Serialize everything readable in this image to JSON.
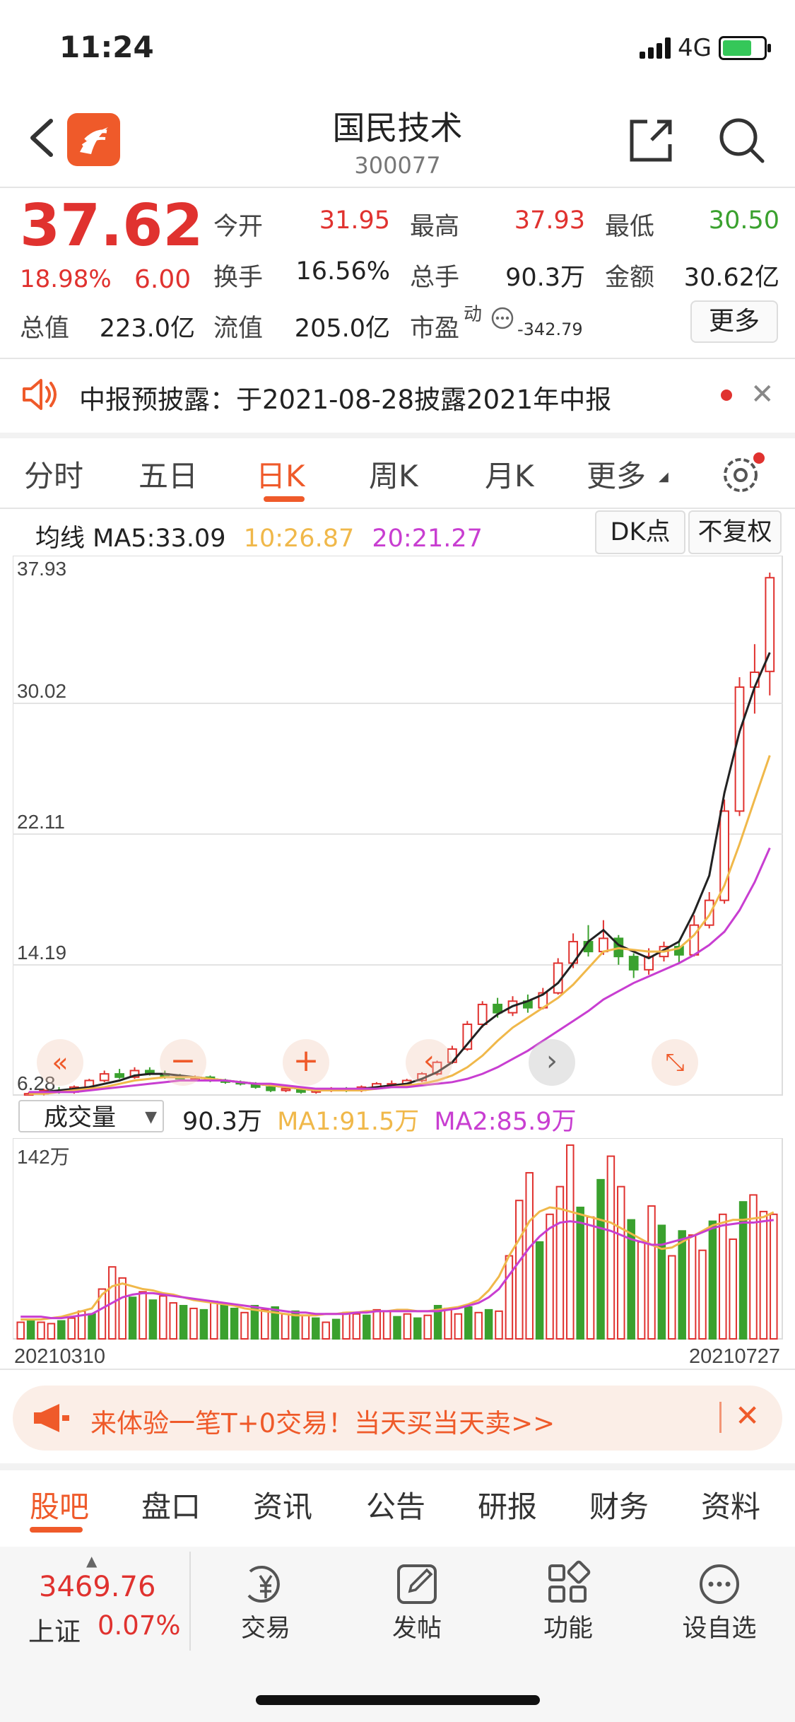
{
  "status": {
    "time": "11:24",
    "network": "4G"
  },
  "header": {
    "name": "国民技术",
    "code": "300077"
  },
  "quote": {
    "price": "37.62",
    "pct": "18.98%",
    "change": "6.00",
    "open_label": "今开",
    "open": "31.95",
    "high_label": "最高",
    "high": "37.93",
    "low_label": "最低",
    "low": "30.50",
    "turnover_label": "换手",
    "turnover": "16.56%",
    "volume_label": "总手",
    "volume": "90.3万",
    "amount_label": "金额",
    "amount": "30.62亿",
    "mktcap_label": "总值",
    "mktcap": "223.0亿",
    "float_label": "流值",
    "float": "205.0亿",
    "pe_label": "市盈",
    "pe_sup": "动",
    "pe": "-342.79",
    "more": "更多"
  },
  "notice": {
    "text": "中报预披露：于2021-08-28披露2021年中报"
  },
  "ktabs": [
    "分时",
    "五日",
    "日K",
    "周K",
    "月K",
    "更多"
  ],
  "ma": {
    "label": "均线",
    "ma5": "MA5:33.09",
    "ma10": "10:26.87",
    "ma20": "20:21.27",
    "btn_dk": "DK点",
    "btn_fq": "不复权",
    "color_ma10": "#f0b84a",
    "color_ma20": "#c83ed1"
  },
  "volume_header": {
    "select": "成交量",
    "value": "90.3万",
    "ma1": "MA1:91.5万",
    "ma2": "MA2:85.9万"
  },
  "chart_data": [
    {
      "type": "candlestick",
      "y_ticks": [
        "37.93",
        "30.02",
        "22.11",
        "14.19",
        "6.28"
      ],
      "ylim": [
        6.28,
        37.93
      ],
      "series": [
        {
          "name": "MA5",
          "values": [
            6.4,
            6.5,
            6.6,
            6.7,
            6.8,
            7.0,
            7.2,
            7.5,
            7.6,
            7.6,
            7.5,
            7.4,
            7.3,
            7.2,
            7.1,
            7.0,
            6.9,
            6.8,
            6.7,
            6.6,
            6.6,
            6.6,
            6.7,
            6.8,
            6.9,
            7.0,
            7.3,
            7.7,
            8.3,
            9.4,
            10.5,
            11.2,
            11.7,
            12.0,
            12.4,
            13.1,
            14.3,
            15.6,
            16.3,
            15.4,
            15.0,
            14.6,
            15.1,
            15.6,
            17.4,
            19.6,
            24.6,
            28.3,
            31.0,
            33.09
          ]
        },
        {
          "name": "10",
          "values": [
            6.4,
            6.4,
            6.5,
            6.6,
            6.7,
            6.8,
            7.0,
            7.2,
            7.3,
            7.4,
            7.4,
            7.4,
            7.3,
            7.2,
            7.1,
            7.0,
            6.9,
            6.8,
            6.7,
            6.6,
            6.6,
            6.6,
            6.6,
            6.7,
            6.8,
            6.9,
            7.0,
            7.2,
            7.5,
            8.0,
            8.7,
            9.6,
            10.4,
            11.0,
            11.6,
            12.2,
            13.0,
            14.0,
            15.0,
            15.2,
            15.1,
            15.0,
            15.0,
            15.2,
            16.0,
            17.2,
            19.0,
            21.5,
            24.2,
            26.87
          ]
        },
        {
          "name": "20",
          "values": [
            6.5,
            6.5,
            6.5,
            6.5,
            6.6,
            6.7,
            6.8,
            6.9,
            7.0,
            7.1,
            7.2,
            7.2,
            7.2,
            7.2,
            7.1,
            7.0,
            7.0,
            6.9,
            6.8,
            6.7,
            6.7,
            6.7,
            6.7,
            6.7,
            6.8,
            6.8,
            6.9,
            7.0,
            7.1,
            7.3,
            7.6,
            8.0,
            8.5,
            9.0,
            9.6,
            10.2,
            10.8,
            11.4,
            12.1,
            12.6,
            13.1,
            13.5,
            13.9,
            14.3,
            14.8,
            15.4,
            16.2,
            17.5,
            19.2,
            21.27
          ]
        }
      ],
      "candles": [
        [
          6.3,
          6.4,
          6.5,
          6.2
        ],
        [
          6.4,
          6.6,
          6.7,
          6.3
        ],
        [
          6.6,
          6.5,
          6.8,
          6.4
        ],
        [
          6.5,
          6.8,
          6.9,
          6.4
        ],
        [
          6.8,
          7.2,
          7.3,
          6.7
        ],
        [
          7.2,
          7.6,
          7.8,
          7.1
        ],
        [
          7.6,
          7.4,
          7.9,
          7.3
        ],
        [
          7.4,
          7.8,
          8.0,
          7.3
        ],
        [
          7.8,
          7.6,
          8.0,
          7.5
        ],
        [
          7.6,
          7.4,
          7.8,
          7.3
        ],
        [
          7.4,
          7.3,
          7.6,
          7.2
        ],
        [
          7.3,
          7.4,
          7.5,
          7.2
        ],
        [
          7.4,
          7.2,
          7.5,
          7.1
        ],
        [
          7.2,
          7.1,
          7.3,
          7.0
        ],
        [
          7.1,
          7.0,
          7.2,
          6.9
        ],
        [
          7.0,
          6.8,
          7.1,
          6.7
        ],
        [
          6.8,
          6.6,
          6.9,
          6.5
        ],
        [
          6.6,
          6.7,
          6.8,
          6.5
        ],
        [
          6.7,
          6.5,
          6.8,
          6.4
        ],
        [
          6.5,
          6.6,
          6.7,
          6.4
        ],
        [
          6.6,
          6.7,
          6.8,
          6.5
        ],
        [
          6.7,
          6.6,
          6.8,
          6.5
        ],
        [
          6.6,
          6.8,
          6.9,
          6.5
        ],
        [
          6.8,
          7.0,
          7.1,
          6.7
        ],
        [
          7.0,
          7.0,
          7.2,
          6.9
        ],
        [
          7.0,
          7.2,
          7.3,
          6.9
        ],
        [
          7.2,
          7.6,
          7.7,
          7.1
        ],
        [
          7.6,
          8.3,
          8.4,
          7.5
        ],
        [
          8.3,
          9.1,
          9.3,
          8.2
        ],
        [
          9.1,
          10.6,
          10.8,
          9.0
        ],
        [
          10.6,
          11.8,
          12.0,
          10.4
        ],
        [
          11.8,
          11.3,
          12.2,
          11.0
        ],
        [
          11.3,
          12.0,
          12.3,
          11.1
        ],
        [
          12.0,
          11.6,
          12.4,
          11.3
        ],
        [
          11.6,
          12.5,
          12.8,
          11.5
        ],
        [
          12.5,
          14.3,
          14.6,
          12.4
        ],
        [
          14.3,
          15.6,
          16.1,
          14.0
        ],
        [
          15.6,
          15.0,
          16.6,
          14.7
        ],
        [
          15.0,
          15.8,
          16.9,
          14.8
        ],
        [
          15.8,
          14.7,
          16.0,
          14.2
        ],
        [
          14.7,
          13.9,
          14.9,
          13.4
        ],
        [
          13.9,
          14.7,
          15.2,
          13.6
        ],
        [
          14.7,
          15.3,
          15.6,
          14.4
        ],
        [
          15.3,
          14.8,
          15.7,
          14.3
        ],
        [
          14.8,
          16.6,
          17.2,
          14.7
        ],
        [
          16.6,
          18.1,
          18.6,
          16.4
        ],
        [
          18.1,
          23.5,
          24.2,
          17.9
        ],
        [
          23.5,
          31.0,
          31.6,
          23.2
        ],
        [
          31.0,
          31.9,
          33.6,
          29.4
        ],
        [
          31.95,
          37.62,
          37.93,
          30.5
        ]
      ]
    },
    {
      "type": "bar",
      "y_ticks": [
        "142万"
      ],
      "ylim": [
        0,
        142
      ],
      "x_ticks": [
        "20210310",
        "20210727"
      ],
      "series": [
        {
          "name": "MA1",
          "values": [
            14,
            14,
            14,
            15,
            16,
            18,
            20,
            22,
            32,
            38,
            40,
            38,
            36,
            35,
            33,
            32,
            30,
            28,
            27,
            26,
            25,
            24,
            22,
            21,
            20,
            19,
            18,
            17,
            17,
            17,
            18,
            18,
            19,
            19,
            20,
            20,
            20,
            21,
            21,
            20,
            20,
            21,
            22,
            23,
            25,
            28,
            35,
            45,
            60,
            72,
            85,
            92,
            95,
            94,
            92,
            90,
            88,
            86,
            84,
            80,
            76,
            72,
            68,
            65,
            66,
            70,
            74,
            78,
            82,
            84,
            86,
            86,
            87,
            88,
            91.5
          ]
        },
        {
          "name": "MA2",
          "values": [
            16,
            16,
            16,
            15,
            15,
            16,
            17,
            18,
            22,
            26,
            30,
            32,
            33,
            33,
            32,
            31,
            30,
            29,
            28,
            27,
            26,
            25,
            24,
            23,
            22,
            21,
            20,
            19,
            19,
            18,
            18,
            18,
            18,
            19,
            19,
            20,
            20,
            20,
            20,
            20,
            20,
            20,
            21,
            22,
            24,
            26,
            30,
            36,
            46,
            56,
            66,
            74,
            80,
            84,
            85,
            84,
            82,
            80,
            78,
            75,
            72,
            70,
            68,
            68,
            70,
            72,
            74,
            77,
            80,
            82,
            83,
            84,
            84,
            85,
            85.9
          ]
        }
      ],
      "values": [
        12,
        14,
        12,
        11,
        13,
        15,
        20,
        18,
        36,
        52,
        44,
        30,
        34,
        28,
        31,
        26,
        24,
        22,
        21,
        27,
        25,
        22,
        19,
        24,
        21,
        23,
        18,
        20,
        17,
        15,
        12,
        14,
        19,
        18,
        17,
        21,
        20,
        16,
        18,
        15,
        17,
        24,
        22,
        18,
        23,
        19,
        21,
        20,
        60,
        100,
        120,
        70,
        90,
        110,
        140,
        95,
        88,
        115,
        132,
        110,
        86,
        70,
        96,
        82,
        60,
        78,
        75,
        64,
        85,
        90,
        72,
        99,
        104,
        92,
        90
      ],
      "up": [
        1,
        0,
        1,
        1,
        0,
        1,
        1,
        0,
        1,
        1,
        1,
        0,
        1,
        0,
        1,
        1,
        0,
        1,
        0,
        1,
        0,
        0,
        1,
        0,
        1,
        0,
        1,
        0,
        1,
        0,
        1,
        0,
        1,
        1,
        0,
        1,
        1,
        0,
        1,
        0,
        1,
        0,
        1,
        1,
        0,
        1,
        0,
        1,
        1,
        1,
        1,
        0,
        1,
        1,
        1,
        0,
        1,
        0,
        1,
        1,
        0,
        1,
        1,
        0,
        1,
        0,
        1,
        1,
        0,
        1,
        1,
        0,
        1,
        1,
        1
      ]
    }
  ],
  "promo": {
    "text": "来体验一笔T+0交易！当天买当天卖>>"
  },
  "info_tabs": [
    "股吧",
    "盘口",
    "资讯",
    "公告",
    "研报",
    "财务",
    "资料"
  ],
  "bottom": {
    "index_value": "3469.76",
    "index_name": "上证",
    "index_pct": "0.07%",
    "nav": [
      "交易",
      "发帖",
      "功能",
      "设自选"
    ]
  }
}
